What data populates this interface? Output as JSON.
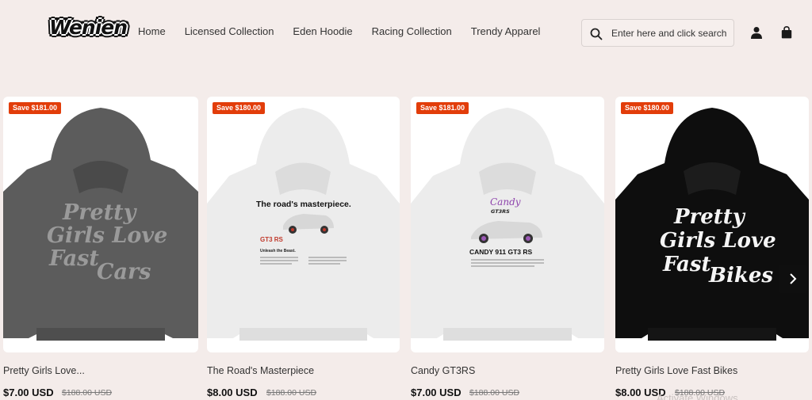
{
  "header": {
    "logo_text": "Wenien",
    "nav": [
      "Home",
      "Licensed Collection",
      "Eden Hoodie",
      "Racing Collection",
      "Trendy Apparel"
    ],
    "search_placeholder": "Enter here and click search"
  },
  "products": [
    {
      "badge": "Save $181.00",
      "title": "Pretty Girls Love...",
      "price": "$7.00 USD",
      "compare_price": "$188.00 USD",
      "print_lines": [
        "Pretty",
        "Girls Love",
        "Fast",
        "Cars"
      ],
      "color": "#5a5a5a"
    },
    {
      "badge": "Save $180.00",
      "title": "The Road's Masterpiece",
      "price": "$8.00 USD",
      "compare_price": "$188.00 USD",
      "print_heading": "The road's masterpiece.",
      "print_model": "GT3 RS",
      "print_sub": "Unleash the Beast.",
      "color": "#ececec"
    },
    {
      "badge": "Save $181.00",
      "title": "Candy GT3RS",
      "price": "$7.00 USD",
      "compare_price": "$188.00 USD",
      "print_script": "Candy",
      "print_script2": "GT3RS",
      "print_model": "CANDY 911 GT3 RS",
      "color": "#ececec"
    },
    {
      "badge": "Save $180.00",
      "title": "Pretty Girls Love Fast Bikes",
      "price": "$8.00 USD",
      "compare_price": "$188.00 USD",
      "print_lines": [
        "Pretty",
        "Girls Love",
        "Fast",
        "Bikes"
      ],
      "color": "#0e0e0e"
    }
  ],
  "watermark": "Activate Windows"
}
